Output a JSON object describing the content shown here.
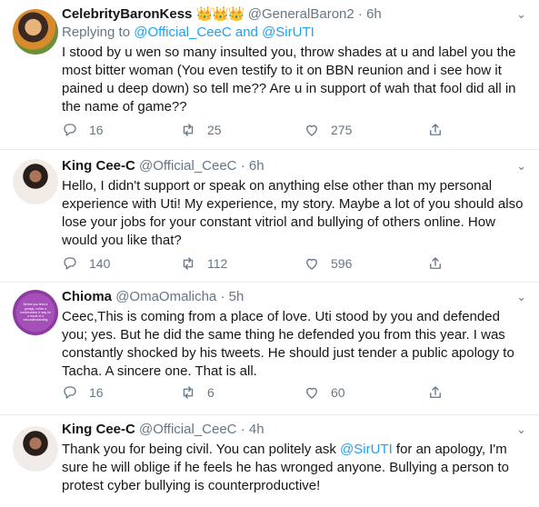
{
  "tweets": [
    {
      "name": "CelebrityBaronKess",
      "badges": "👑👑👑",
      "handle": "@GeneralBaron2",
      "time": "6h",
      "reply_prefix": "Replying to ",
      "reply_to": "@Official_CeeC and @SirUTI",
      "text": "I stood by u wen so many insulted you, throw shades at u and label you the most bitter woman (You even testify to it on BBN reunion and i see how it pained u deep down) so tell me?? Are u in support of wah that fool did all in the name of game??",
      "replies": "16",
      "retweets": "25",
      "likes": "275"
    },
    {
      "name": "King Cee-C",
      "handle": "@Official_CeeC",
      "time": "6h",
      "text": "Hello, I didn't support or speak on anything else other than my personal experience with Uti! My experience, my story. Maybe a lot of you should also lose your jobs for your constant vitriol and bullying of others online. How would you like that?",
      "replies": "140",
      "retweets": "112",
      "likes": "596"
    },
    {
      "name": "Chioma",
      "handle": "@OmaOmalicha",
      "time": "5h",
      "avatar_text": "Before you feed a grudge, notice a conversation it may be a result of a misunderstanding",
      "text": "Ceec,This is coming from a place of love. Uti stood by you and defended you; yes. But he did the same thing he defended you from this year. I was constantly shocked by his tweets. He should just tender a public apology to Tacha. A sincere one. That is all.",
      "replies": "16",
      "retweets": "6",
      "likes": "60"
    },
    {
      "name": "King Cee-C",
      "handle": "@Official_CeeC",
      "time": "4h",
      "text_before": "Thank you for being civil. You can politely ask ",
      "mention": "@SirUTI",
      "text_after": " for an apology, I'm sure he will oblige if he feels he has wronged anyone. Bullying a person to protest cyber bullying is counterproductive!"
    }
  ],
  "colors": {
    "link": "#1da1f2",
    "muted": "#657786",
    "divider": "#e6ecf0",
    "thread": "#ccd6dd"
  },
  "icons": [
    "reply-icon",
    "retweet-icon",
    "like-icon",
    "share-icon",
    "more-caret-icon"
  ]
}
